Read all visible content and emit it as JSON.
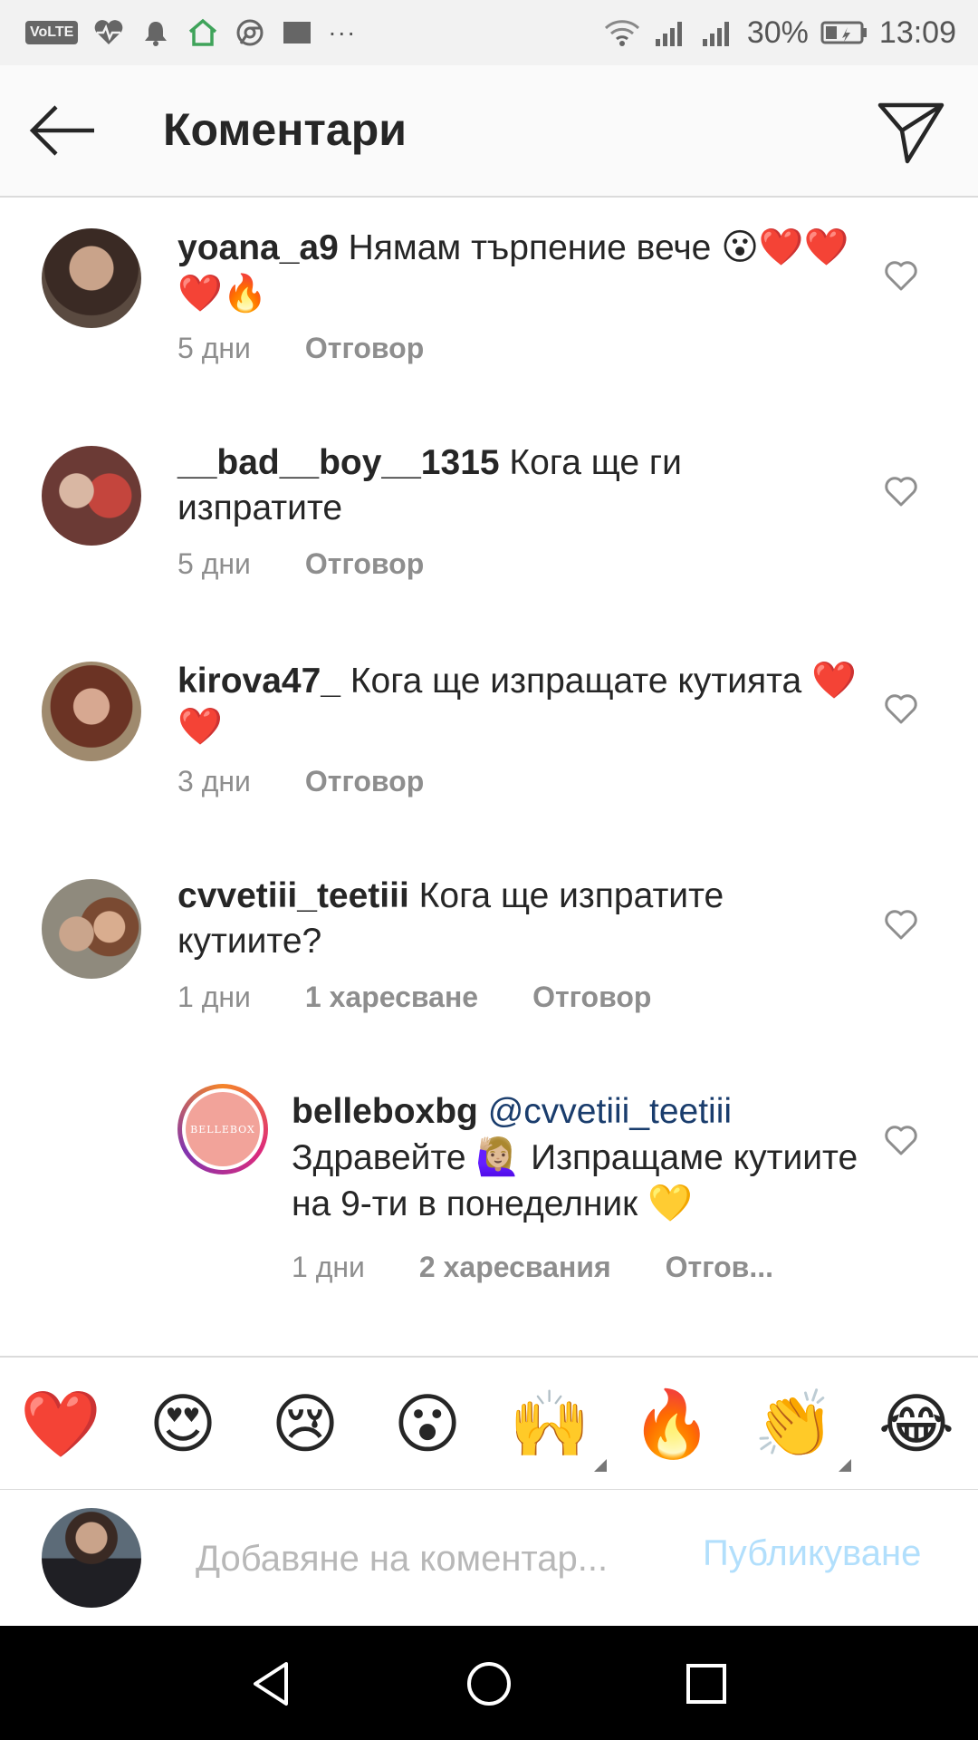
{
  "status_bar": {
    "volte": "VoLTE",
    "battery": "30%",
    "time": "13:09",
    "dots": "···"
  },
  "header": {
    "title": "Коментари"
  },
  "comments": [
    {
      "username": "yoana_a9",
      "text": "Нямам търпение вече",
      "emoji": "😮❤️❤️❤️🔥",
      "time": "5 дни",
      "likes": "",
      "reply": "Отговор"
    },
    {
      "username": "__bad__boy__1315",
      "text": "Кога ще ги изпратите",
      "emoji": "",
      "time": "5 дни",
      "likes": "",
      "reply": "Отговор"
    },
    {
      "username": "kirova47_",
      "text": "Кога ще изпращате кутията",
      "emoji": "❤️❤️",
      "time": "3 дни",
      "likes": "",
      "reply": "Отговор"
    },
    {
      "username": "cvvetiii_teetiii",
      "text": "Кога ще изпратите кутиите?",
      "emoji": "",
      "time": "1 дни",
      "likes": "1 харесване",
      "reply": "Отговор"
    }
  ],
  "reply_comment": {
    "username": "belleboxbg",
    "mention": "@cvvetiii_teetiii",
    "text_before_emoji": "Здравейте",
    "emoji_wave": "🙋🏼‍♀️",
    "text_after_emoji": "Изпращаме кутиите на 9-ти в понеделник",
    "emoji_heart": "💛",
    "avatar_text": "BELLEBOX",
    "time": "1 дни",
    "likes": "2 харесвания",
    "reply": "Отгов..."
  },
  "quick_emojis": [
    "❤️",
    "😍",
    "😢",
    "😮",
    "🙌",
    "🔥",
    "👏",
    "😂"
  ],
  "composer": {
    "placeholder": "Добавяне на коментар...",
    "publish_label": "Публикуване"
  },
  "colors": {
    "accent_disabled": "#b2dffc",
    "mention": "#1a3d6d",
    "meta_gray": "#8e8e8e"
  }
}
